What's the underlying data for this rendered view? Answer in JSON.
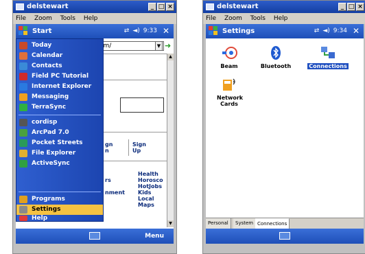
{
  "left": {
    "window_title": "delstewart",
    "menubar": [
      "File",
      "Zoom",
      "Tools",
      "Help"
    ],
    "nav_title": "Start",
    "time": "9:33",
    "close_label": "✕",
    "address_value": "om/",
    "page_links": {
      "col1": [
        "gn",
        "n"
      ],
      "col2": [
        "Sign",
        "Up"
      ],
      "list1": [
        "Health",
        "Horosco",
        "HotJobs",
        "Kids",
        "Local",
        "Maps"
      ],
      "left_frag": [
        "rs",
        "nment"
      ]
    },
    "start_menu": {
      "top": [
        {
          "label": "Today",
          "color": "#c84a2a"
        },
        {
          "label": "Calendar",
          "color": "#e0703a"
        },
        {
          "label": "Contacts",
          "color": "#3a8ad8"
        },
        {
          "label": "Field PC Tutorial",
          "color": "#d02a2a"
        },
        {
          "label": "Internet Explorer",
          "color": "#2a7ae0"
        },
        {
          "label": "Messaging",
          "color": "#f0a020"
        },
        {
          "label": "TerraSync",
          "color": "#30b040"
        }
      ],
      "middle": [
        {
          "label": "cordisp",
          "color": "#555555"
        },
        {
          "label": "ArcPad 7.0",
          "color": "#4aa040"
        },
        {
          "label": "Pocket Streets",
          "color": "#2a9a5a"
        },
        {
          "label": "File Explorer",
          "color": "#e0b030"
        },
        {
          "label": "ActiveSync",
          "color": "#30a040"
        }
      ],
      "bottom": [
        {
          "label": "Programs",
          "color": "#e0a020"
        },
        {
          "label": "Settings",
          "color": "#c0c0c0"
        },
        {
          "label": "Help",
          "color": "#e03a3a"
        }
      ],
      "selected": "Settings"
    },
    "bottom_menu": "Menu"
  },
  "right": {
    "window_title": "delstewart",
    "menubar": [
      "File",
      "Zoom",
      "Tools",
      "Help"
    ],
    "nav_title": "Settings",
    "time": "9:34",
    "close_label": "✕",
    "icons": [
      {
        "label": "Beam",
        "selected": false
      },
      {
        "label": "Bluetooth",
        "selected": false
      },
      {
        "label": "Connections",
        "selected": true
      },
      {
        "label": "Network Cards",
        "selected": false
      }
    ],
    "tabs": [
      "Personal",
      "System",
      "Connections"
    ],
    "active_tab": "Connections"
  }
}
